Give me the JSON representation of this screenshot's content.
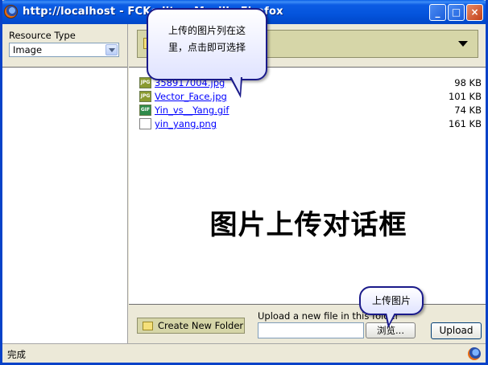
{
  "window": {
    "title": "http://localhost - FCKeditor - Resources Browser - Mozilla Firefox",
    "title_visible": "http://localhost - FCKedito                              - Mozilla Firefox",
    "controls": {
      "minimize": "_",
      "maximize": "□",
      "close": "×"
    }
  },
  "sidebar": {
    "resource_type_label": "Resource Type",
    "resource_type_value": "Image"
  },
  "files": [
    {
      "name": "358917004.jpg",
      "size": "98 KB",
      "type": "jpg"
    },
    {
      "name": "Vector_Face.jpg",
      "size": "101 KB",
      "type": "jpg"
    },
    {
      "name": "Yin_vs__Yang.gif",
      "size": "74 KB",
      "type": "gif"
    },
    {
      "name": "yin_yang.png",
      "size": "161 KB",
      "type": "png"
    }
  ],
  "file_icon_labels": {
    "jpg": "JPG",
    "gif": "GIF",
    "png": ""
  },
  "watermark": "图片上传对话框",
  "upload": {
    "new_folder_label": "Create New Folder",
    "upload_label": "Upload a new file in this folder",
    "browse_label": "浏览...",
    "upload_button": "Upload"
  },
  "status": {
    "text": "完成"
  },
  "callouts": {
    "file_list_note": "上传的图片列在这里，点击即可选择",
    "upload_note": "上传图片"
  },
  "colors": {
    "titlebar": "#0454dc",
    "link": "#0000ff",
    "folder_bar": "#d6d6a8",
    "callout_border": "#1a1a8a"
  }
}
